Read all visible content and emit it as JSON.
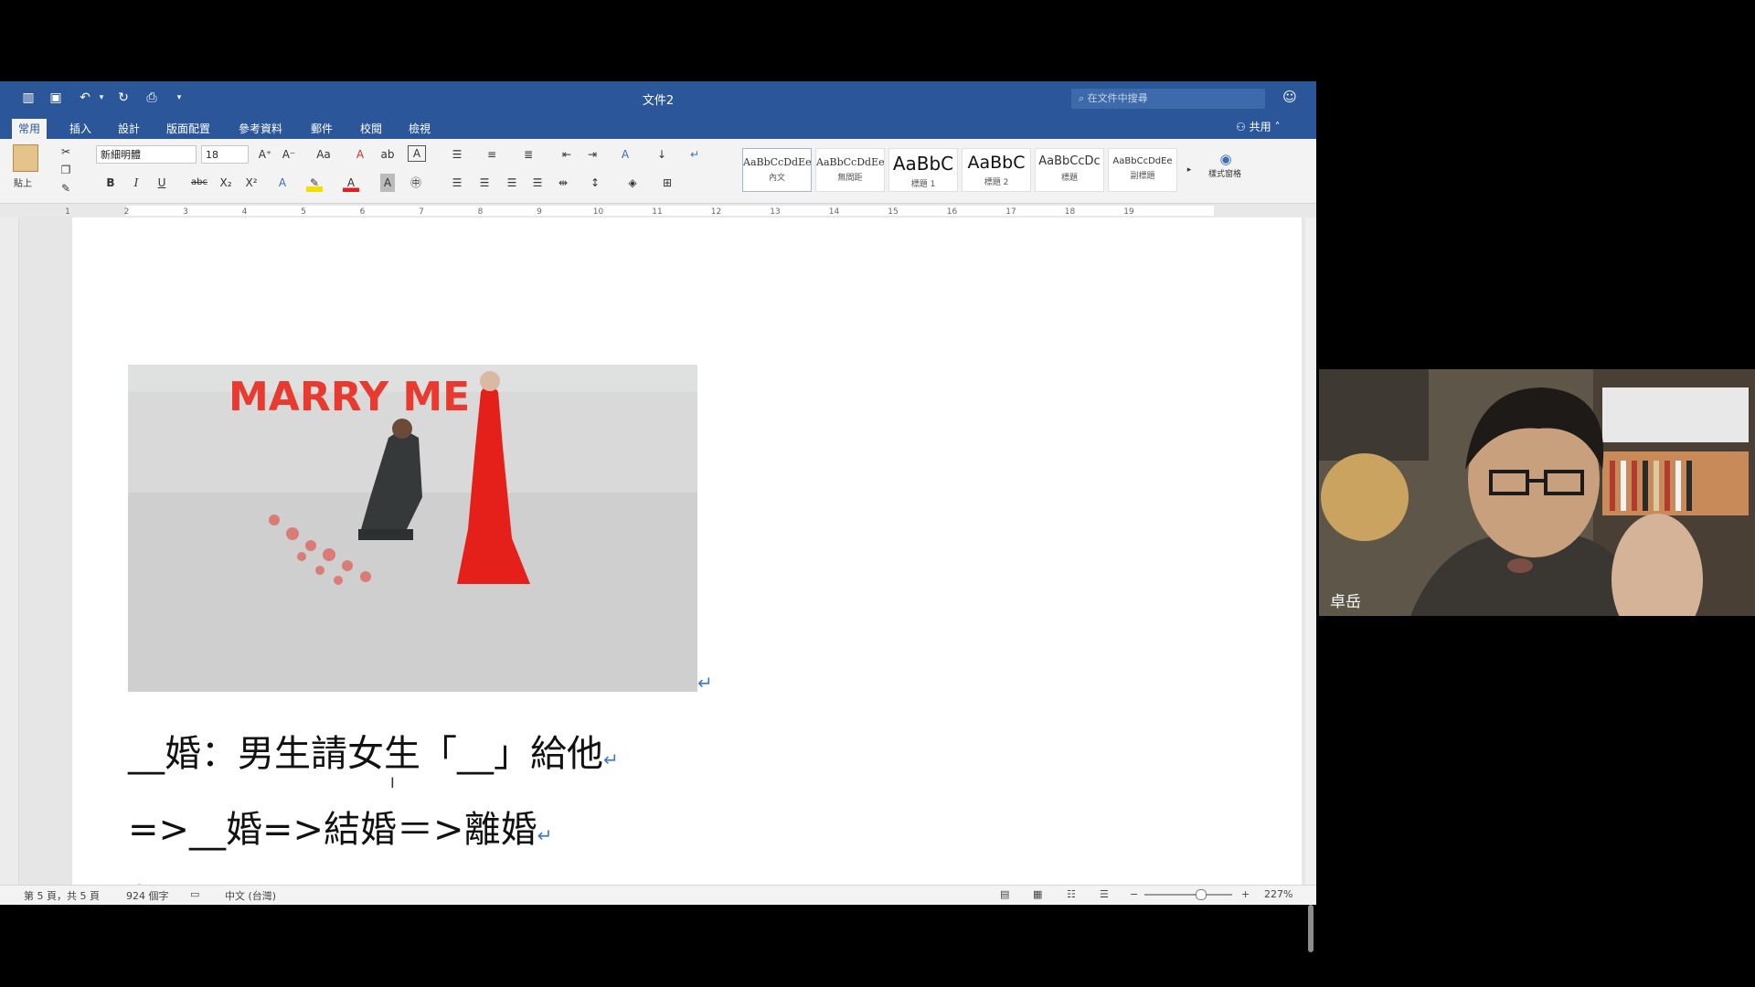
{
  "window": {
    "title": "文件2",
    "search_placeholder": "在文件中搜尋",
    "share_label": "共用"
  },
  "tabs": [
    "常用",
    "插入",
    "設計",
    "版面配置",
    "參考資料",
    "郵件",
    "校閱",
    "檢視"
  ],
  "ribbon": {
    "paste_label": "貼上",
    "font_name": "新細明體",
    "font_size": "18",
    "styles": [
      {
        "preview": "AaBbCcDdEe",
        "name": "內文"
      },
      {
        "preview": "AaBbCcDdEe",
        "name": "無間距"
      },
      {
        "preview": "AaBbC",
        "name": "標題 1"
      },
      {
        "preview": "AaBbC",
        "name": "標題 2"
      },
      {
        "preview": "AaBbCcDc",
        "name": "標題"
      },
      {
        "preview": "AaBbCcDdEe",
        "name": "副標題"
      }
    ],
    "styles_pane_label": "樣式窗格"
  },
  "ruler_numbers": [
    "1",
    "2",
    "3",
    "4",
    "5",
    "6",
    "7",
    "8",
    "9",
    "10",
    "11",
    "12",
    "13",
    "14",
    "15",
    "16",
    "17",
    "18",
    "19"
  ],
  "document": {
    "image_text": "MARRY ME",
    "line1": "__婚：男生請女生「__」給他",
    "line2": "=>__婚=>結婚＝>離婚"
  },
  "status": {
    "page": "第 5 頁，共 5 頁",
    "words": "924 個字",
    "language": "中文 (台灣)",
    "zoom": "227%"
  },
  "video": {
    "participant_name": "卓岳"
  }
}
